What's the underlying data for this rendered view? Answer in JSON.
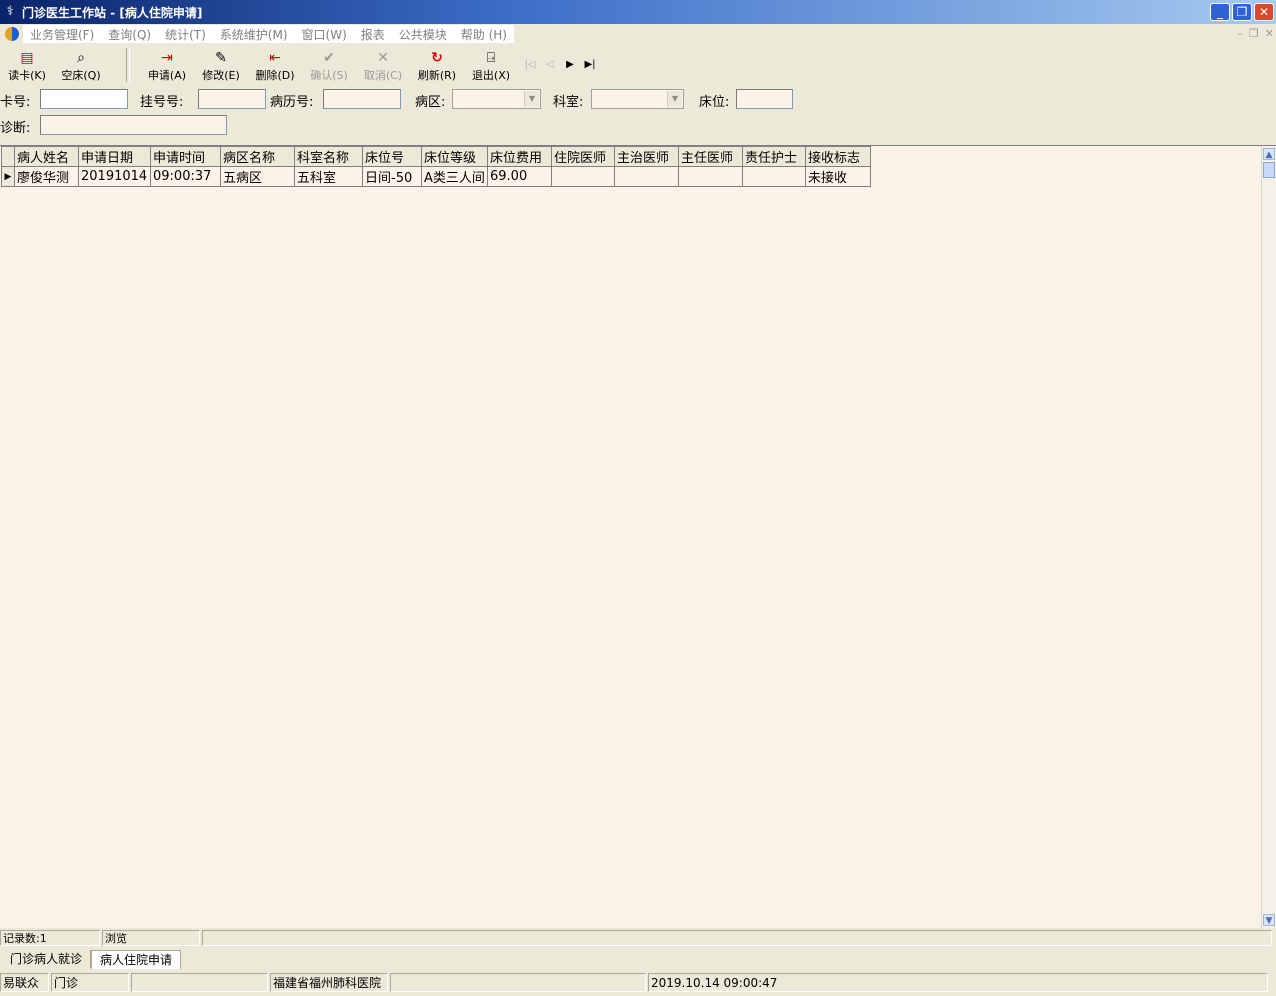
{
  "window": {
    "title": "门诊医生工作站 - [病人住院申请]",
    "app_icon": "caduceus-icon",
    "controls": {
      "minimize": "_",
      "restore": "❐",
      "close": "✕"
    }
  },
  "menu": {
    "items": [
      "业务管理(F)",
      "查询(Q)",
      "统计(T)",
      "系统维护(M)",
      "窗口(W)",
      "报表",
      "公共模块",
      "帮助 (H)"
    ]
  },
  "toolbar": {
    "read_card": "读卡(K)",
    "empty_bed": "空床(Q)",
    "apply": "申请(A)",
    "modify": "修改(E)",
    "delete": "删除(D)",
    "confirm": "确认(S)",
    "cancel": "取消(C)",
    "refresh": "刷新(R)",
    "exit": "退出(X)"
  },
  "filters": {
    "card_label": "卡号:",
    "reg_label": "挂号号:",
    "record_label": "病历号:",
    "ward_label": "病区:",
    "dept_label": "科室:",
    "bed_label": "床位:",
    "diag_label": "诊断:"
  },
  "grid": {
    "columns": [
      "病人姓名",
      "申请日期",
      "申请时间",
      "病区名称",
      "科室名称",
      "床位号",
      "床位等级",
      "床位费用",
      "住院医师",
      "主治医师",
      "主任医师",
      "责任护士",
      "接收标志"
    ],
    "rows": [
      [
        "廖俊华测",
        "20191014",
        "09:00:37",
        "五病区",
        "五科室",
        "日间-50",
        "A类三人间",
        "69.00",
        "",
        "",
        "",
        "",
        "未接收"
      ]
    ]
  },
  "status": {
    "record_count": "记录数:1",
    "mode": "浏览"
  },
  "tabs": [
    "门诊病人就诊",
    "病人住院申请"
  ],
  "bottom": {
    "user": "易联众",
    "dept": "门诊",
    "blank": "",
    "hospital": "福建省福州肺科医院",
    "datetime": "2019.10.14 09:00:47"
  },
  "colors": {
    "grid_bg": "#FDF2E8",
    "chrome": "#ECE9D8",
    "title_from": "#0A246A",
    "title_to": "#A6CAF0"
  }
}
